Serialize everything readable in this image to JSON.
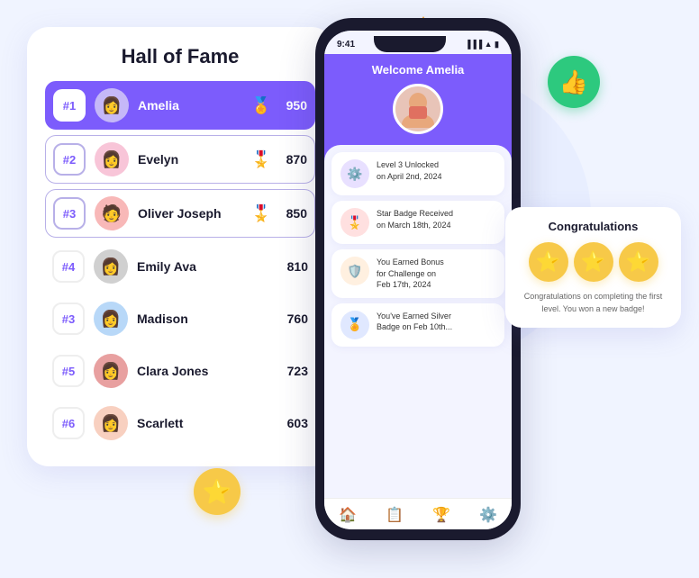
{
  "page": {
    "bg_color": "#f0f4ff"
  },
  "hall_of_fame": {
    "title": "Hall of Fame",
    "rows": [
      {
        "rank": "#1",
        "name": "Amelia",
        "score": "950",
        "medal": "🥇",
        "style": "rank-1",
        "avatar": "👩"
      },
      {
        "rank": "#2",
        "name": "Evelyn",
        "score": "870",
        "medal": "🥈",
        "style": "rank-2",
        "avatar": "👩"
      },
      {
        "rank": "#3",
        "name": "Oliver Joseph",
        "score": "850",
        "medal": "🥉",
        "style": "rank-3",
        "avatar": "🧑"
      },
      {
        "rank": "#4",
        "name": "Emily Ava",
        "score": "810",
        "medal": "",
        "style": "rank-4",
        "avatar": "👩"
      },
      {
        "rank": "#3",
        "name": "Madison",
        "score": "760",
        "medal": "",
        "style": "rank-5",
        "avatar": "👩"
      },
      {
        "rank": "#5",
        "name": "Clara Jones",
        "score": "723",
        "medal": "",
        "style": "rank-6",
        "avatar": "👩"
      },
      {
        "rank": "#6",
        "name": "Scarlett",
        "score": "603",
        "medal": "",
        "style": "rank-7",
        "avatar": "👩"
      }
    ]
  },
  "phone": {
    "time": "9:41",
    "welcome": "Welcome Amelia",
    "feed": [
      {
        "text": "Level 3 Unlocked\non April 2nd, 2024",
        "icon": "⚙️",
        "icon_bg": "#e8e0ff"
      },
      {
        "text": "Star Badge Received\non March 18th, 2024",
        "icon": "🎖️",
        "icon_bg": "#ffe0e0"
      },
      {
        "text": "You Earned Bonus\nfor Challenge on\nFeb 17th, 2024",
        "icon": "🛡️",
        "icon_bg": "#fff0e0"
      },
      {
        "text": "You've Earned Silver\nBadge on Feb 10th...",
        "icon": "🏅",
        "icon_bg": "#e0e8ff"
      }
    ]
  },
  "congrats": {
    "title": "Congratulations",
    "text": "Congratulations on completing the first level. You won a new badge!"
  },
  "decorations": {
    "thumbs_up": "👍",
    "star": "⭐",
    "triangle_color": "#f7a325",
    "green_circle_color": "#2dc97e",
    "star_circle_color": "#f7c948"
  }
}
